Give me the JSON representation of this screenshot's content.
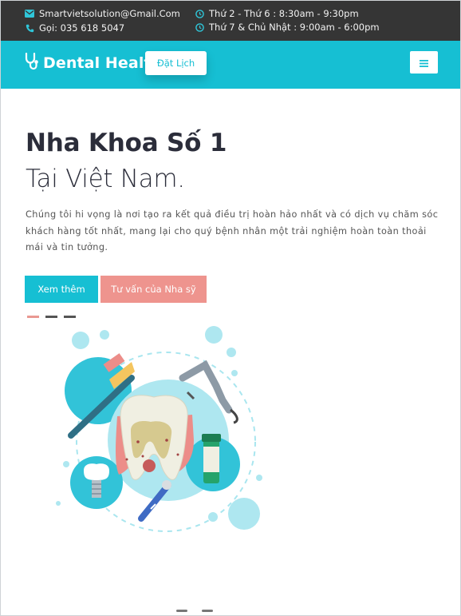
{
  "topbar": {
    "email": "Smartvietsolution@Gmail.Com",
    "phone": "Gọi: 035 618 5047",
    "hours_weekday": "Thứ 2 - Thứ 6 : 8:30am - 9:30pm",
    "hours_weekend": "Thứ 7 & Chủ Nhật : 9:00am - 6:00pm"
  },
  "navbar": {
    "brand": "Dental Health",
    "book_label": "Đặt Lịch",
    "accent": "#16bfd3"
  },
  "hero": {
    "title": "Nha Khoa Số 1",
    "subtitle": "Tại Việt Nam.",
    "description": "Chúng tôi hi vọng là nơi tạo ra kết quả điều trị hoàn hảo nhất và có dịch vụ chăm sóc khách hàng tốt nhất, mang lại cho quý bệnh nhân một trải nghiệm hoàn toàn thoải mái và tin tưởng.",
    "more_label": "Xem thêm",
    "advice_label": "Tư vấn của Nha sỹ",
    "slide_count": 3,
    "active_slide": 1
  },
  "icons": {
    "email": "envelope-icon",
    "phone": "phone-icon",
    "clock": "clock-icon",
    "brand": "stethoscope-icon",
    "menu": "hamburger-icon"
  },
  "colors": {
    "topbar": "#353535",
    "primary": "#16bfd3",
    "secondary": "#ee948e",
    "heading": "#2b2d3a"
  }
}
